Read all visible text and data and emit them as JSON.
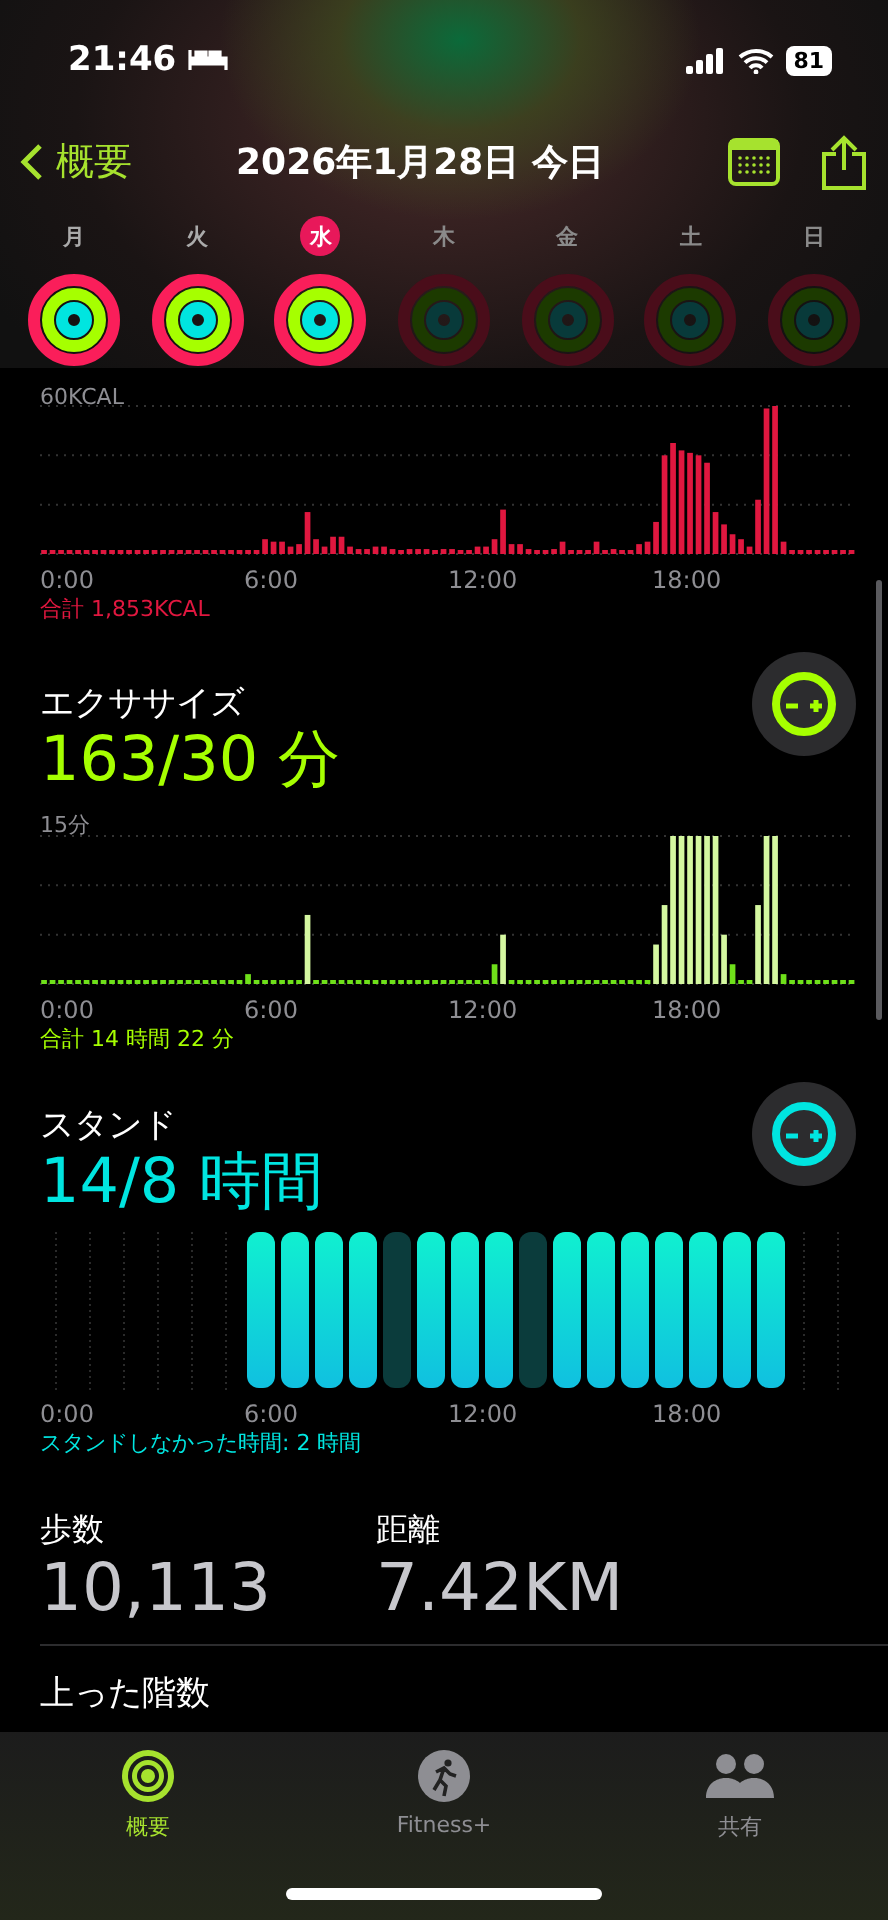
{
  "status_bar": {
    "time": "21:46",
    "battery": "81"
  },
  "nav": {
    "back": "概要",
    "title": "2026年1月28日 今日"
  },
  "week": [
    {
      "label": "月",
      "selected": false,
      "closed": true
    },
    {
      "label": "火",
      "selected": false,
      "closed": true
    },
    {
      "label": "水",
      "selected": true,
      "closed": true
    },
    {
      "label": "木",
      "selected": false,
      "closed": false
    },
    {
      "label": "金",
      "selected": false,
      "closed": false
    },
    {
      "label": "土",
      "selected": false,
      "closed": false
    },
    {
      "label": "日",
      "selected": false,
      "closed": false
    }
  ],
  "move": {
    "y_label": "60KCAL",
    "axis_labels": [
      "0:00",
      "6:00",
      "12:00",
      "18:00"
    ],
    "total": "合計 1,853KCAL"
  },
  "exercise": {
    "title": "エクササイズ",
    "value": "163/30 分",
    "y_label": "15分",
    "axis_labels": [
      "0:00",
      "6:00",
      "12:00",
      "18:00"
    ],
    "total": "合計 14 時間 22 分"
  },
  "stand": {
    "title": "スタンド",
    "value": "14/8 時間",
    "axis_labels": [
      "0:00",
      "6:00",
      "12:00",
      "18:00"
    ],
    "caption": "スタンドしなかった時間: 2 時間",
    "hours": [
      {
        "kind": "empty"
      },
      {
        "kind": "empty"
      },
      {
        "kind": "empty"
      },
      {
        "kind": "empty"
      },
      {
        "kind": "empty"
      },
      {
        "kind": "empty"
      },
      {
        "kind": "stood"
      },
      {
        "kind": "stood"
      },
      {
        "kind": "stood"
      },
      {
        "kind": "stood"
      },
      {
        "kind": "missed"
      },
      {
        "kind": "stood"
      },
      {
        "kind": "stood"
      },
      {
        "kind": "stood"
      },
      {
        "kind": "missed"
      },
      {
        "kind": "stood"
      },
      {
        "kind": "stood"
      },
      {
        "kind": "stood"
      },
      {
        "kind": "stood"
      },
      {
        "kind": "stood"
      },
      {
        "kind": "stood"
      },
      {
        "kind": "stood"
      },
      {
        "kind": "empty"
      },
      {
        "kind": "empty"
      }
    ]
  },
  "stats": [
    {
      "label": "歩数",
      "value": "10,113"
    },
    {
      "label": "距離",
      "value": "7.42KM"
    }
  ],
  "floors": {
    "label": "上った階数"
  },
  "tab_bar": [
    {
      "kind": "summary",
      "label": "概要",
      "selected": true
    },
    {
      "kind": "fitness",
      "label": "Fitness+",
      "selected": false
    },
    {
      "kind": "sharing",
      "label": "共有",
      "selected": false
    }
  ]
}
